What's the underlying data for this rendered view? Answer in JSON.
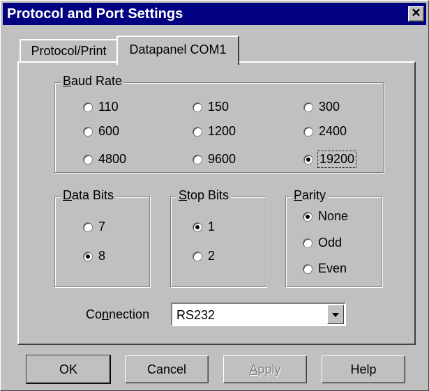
{
  "window": {
    "title": "Protocol and Port Settings",
    "close_glyph": "✕"
  },
  "tabs": [
    {
      "label": "Protocol/Print",
      "selected": false
    },
    {
      "label": "Datapanel COM1",
      "selected": true
    }
  ],
  "baud_rate": {
    "legend_mnemonic": "B",
    "legend_rest": "aud Rate",
    "options": [
      "110",
      "150",
      "300",
      "600",
      "1200",
      "2400",
      "4800",
      "9600",
      "19200"
    ],
    "selected": "19200"
  },
  "data_bits": {
    "legend_mnemonic": "D",
    "legend_rest": "ata Bits",
    "options": [
      "7",
      "8"
    ],
    "selected": "8"
  },
  "stop_bits": {
    "legend_mnemonic": "S",
    "legend_rest": "top Bits",
    "options": [
      "1",
      "2"
    ],
    "selected": "1"
  },
  "parity": {
    "legend_mnemonic": "P",
    "legend_rest": "arity",
    "options": [
      "None",
      "Odd",
      "Even"
    ],
    "selected": "None"
  },
  "connection": {
    "label_pre": "Co",
    "label_mnemonic": "n",
    "label_post": "nection",
    "value": "RS232"
  },
  "buttons": {
    "ok": "OK",
    "cancel": "Cancel",
    "apply_mnemonic": "A",
    "apply_rest": "pply",
    "apply_enabled": false,
    "help": "Help"
  },
  "icons": {
    "close": "close-icon",
    "dropdown": "chevron-down-icon",
    "radio": "radio-button-icon"
  }
}
